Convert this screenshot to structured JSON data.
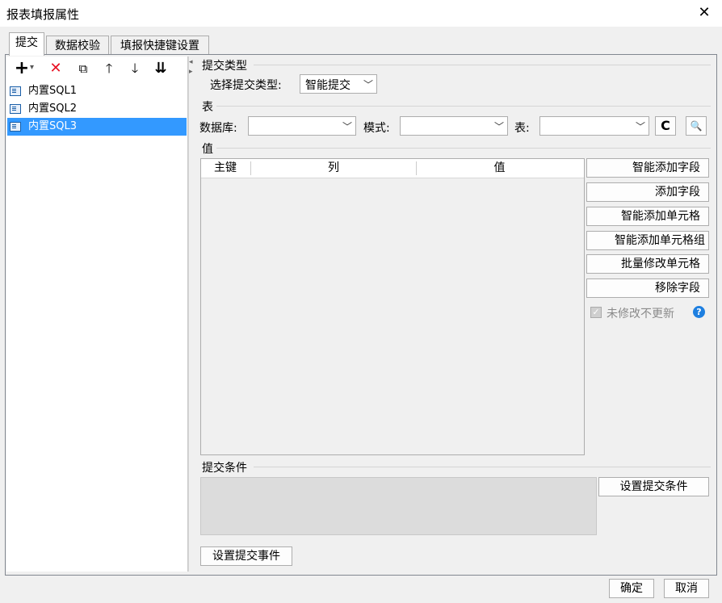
{
  "window": {
    "title": "报表填报属性",
    "close_glyph": "✕"
  },
  "tabs": [
    {
      "label": "提交"
    },
    {
      "label": "数据校验"
    },
    {
      "label": "填报快捷键设置"
    }
  ],
  "toolbar": {
    "add_icon": "+",
    "add_dropdown": "▾",
    "delete_icon": "✕",
    "copy_icon": "⧉",
    "up_icon": "🡑",
    "down_icon": "🡓",
    "sort_icon": "⇊"
  },
  "tree": {
    "items": [
      {
        "label": "内置SQL1"
      },
      {
        "label": "内置SQL2"
      },
      {
        "label": "内置SQL3",
        "selected": true
      }
    ]
  },
  "splitter": {
    "up": "◂",
    "down": "▸"
  },
  "submit_type": {
    "section_label": "提交类型",
    "field_label": "选择提交类型:",
    "value": "智能提交"
  },
  "table_section": {
    "section_label": "表",
    "database_label": "数据库:",
    "database_value": "",
    "schema_label": "模式:",
    "schema_value": "",
    "table_label": "表:",
    "table_value": "",
    "refresh_icon": "C",
    "preview_icon": "🔍"
  },
  "values_section": {
    "section_label": "值",
    "columns": [
      "主键",
      "列",
      "值"
    ],
    "rows": []
  },
  "side_buttons": [
    "智能添加字段",
    "添加字段",
    "智能添加单元格",
    "智能添加单元格组",
    "批量修改单元格",
    "移除字段"
  ],
  "no_update_checkbox": {
    "label": "未修改不更新",
    "checked": true,
    "help": "?"
  },
  "condition": {
    "section_label": "提交条件",
    "set_button": "设置提交条件",
    "event_button": "设置提交事件"
  },
  "footer": {
    "ok": "确定",
    "cancel": "取消"
  },
  "colors": {
    "selection": "#3399ff",
    "delete_red": "#e81123",
    "help_blue": "#1e7fe0"
  }
}
